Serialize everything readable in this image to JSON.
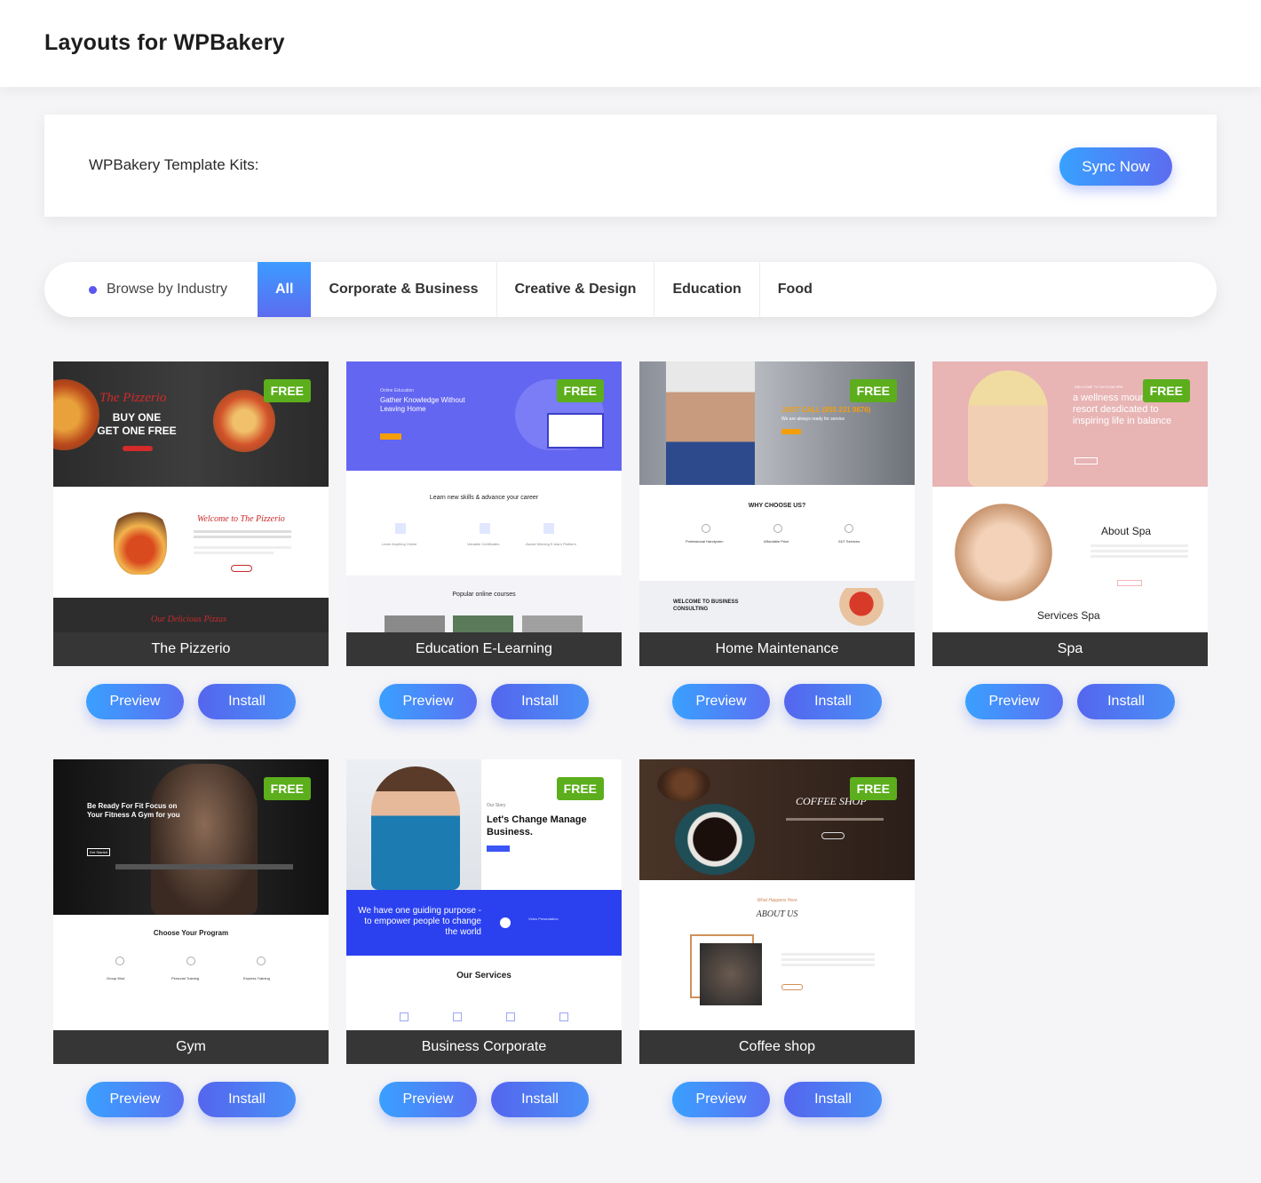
{
  "page_title": "Layouts for WPBakery",
  "kits": {
    "label": "WPBakery Template Kits:",
    "sync_button": "Sync Now"
  },
  "filter": {
    "browse_label": "Browse by Industry",
    "tabs": [
      "All",
      "Corporate & Business",
      "Creative & Design",
      "Education",
      "Food"
    ],
    "active_tab": "All"
  },
  "buttons": {
    "preview": "Preview",
    "install": "Install",
    "badge": "FREE"
  },
  "colors": {
    "accent_start": "#38a1ff",
    "accent_end": "#5c6cf0",
    "badge": "#5cae1c",
    "name_bar": "#363636"
  },
  "templates": [
    {
      "name": "The Pizzerio",
      "hero_script": "The Pizzerio",
      "hero_line1": "BUY ONE",
      "hero_line2": "GET ONE FREE",
      "section_title": "Welcome to The Pizzerio",
      "footer_title": "Our Delicious Pizzas"
    },
    {
      "name": "Education E-Learning",
      "hero_small": "Online Education",
      "hero_title": "Gather Knowledge Without Leaving Home",
      "section_title": "Learn new skills & advance your career",
      "features": [
        "Learn Anything Online",
        "Valuable Certificates",
        "Award Winning E-learn Platform"
      ],
      "footer_title": "Popular online courses"
    },
    {
      "name": "Home Maintenance",
      "hero_call": "JUST CALL (855 231 9876)",
      "hero_sub": "We are always ready for service",
      "section_title": "WHY CHOOSE US?",
      "features": [
        "Professional Handymen",
        "Affordable Price",
        "24/7 Services"
      ],
      "footer_title": "WELCOME TO BUSINESS CONSULTING"
    },
    {
      "name": "Spa",
      "hero_text": "a wellness mountain resort desdicated to inspiring life in balance",
      "hero_small": "WELCOME TO SKYDOM SPA",
      "section_title": "About Spa",
      "footer_title": "Services Spa"
    },
    {
      "name": "Gym",
      "hero_title": "Be Ready For Fit Focus on Your Fitness A Gym for you",
      "hero_btn": "Get Started",
      "section_title": "Choose Your Program",
      "features": [
        "Group Wod",
        "Personal Training",
        "Express Training"
      ]
    },
    {
      "name": "Business Corporate",
      "hero_small": "Our Story",
      "hero_title": "Let's Change Manage Business.",
      "band_text": "We have one guiding purpose - to empower people to change the world",
      "band_small": "Video Presentation",
      "section_title": "Our Services"
    },
    {
      "name": "Coffee shop",
      "hero_title": "COFFEE SHOP",
      "section_small": "What Happens Here",
      "section_title": "ABOUT US"
    }
  ]
}
